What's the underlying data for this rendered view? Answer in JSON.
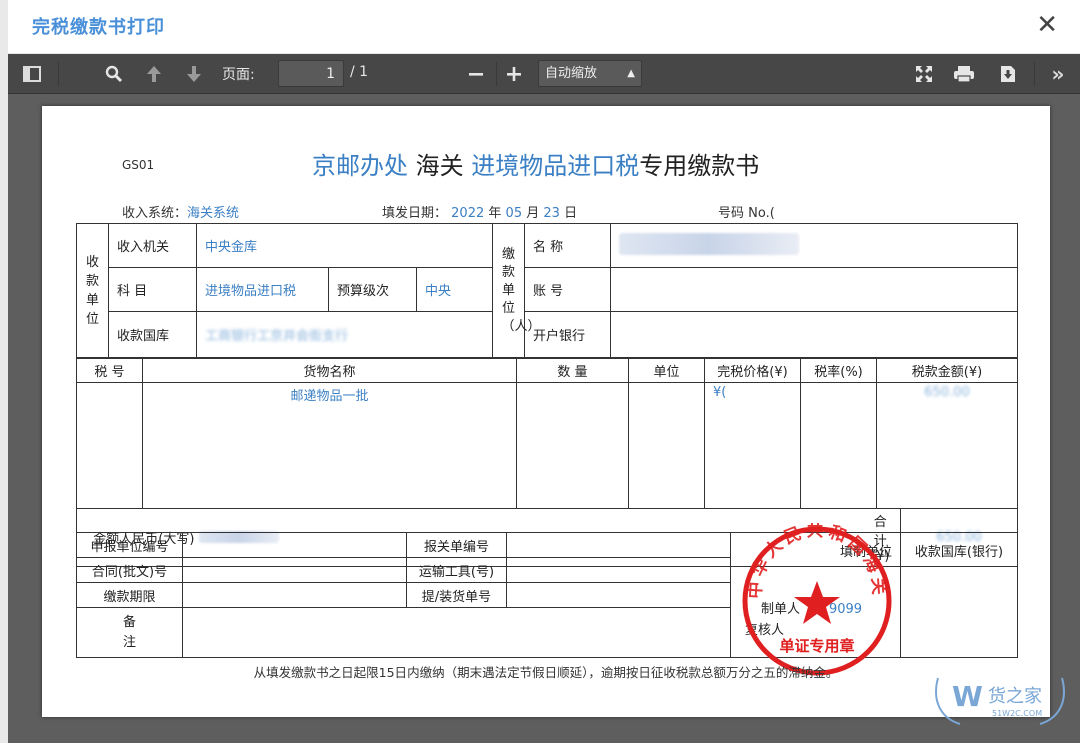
{
  "modal": {
    "title": "完税缴款书打印",
    "close_glyph": "✕"
  },
  "toolbar": {
    "page_label": "页面:",
    "page_value": "1",
    "page_total": "/ 1",
    "zoom_value": "自动缩放"
  },
  "doc": {
    "code": "GS01",
    "title_part1": "京邮办处",
    "title_part2": "海关",
    "title_part3": "进境物品进口税",
    "title_part4": "专用缴款书",
    "income_system_label": "收入系统：",
    "income_system_value": "海关系统",
    "fill_date_label": "填发日期：",
    "fill_date_year": "2022",
    "fill_date_year_unit": "年",
    "fill_date_month": "05",
    "fill_date_month_unit": "月",
    "fill_date_day": "23",
    "fill_date_day_unit": "日",
    "number_label": "号码 No.(",
    "collector_group": "收款单位",
    "receiver_label": "收入机关",
    "receiver_value": "中央金库",
    "subject_label": "科 目",
    "subject_value": "进境物品进口税",
    "budget_label": "预算级次",
    "budget_value": "中央",
    "treasury_label": "收款国库",
    "treasury_value": "工商银行工京井会街支行",
    "payer_group": "缴款单位（人）",
    "name_label": "名 称",
    "account_label": "账 号",
    "bank_label": "开户银行",
    "col_tax_no": "税 号",
    "col_goods": "货物名称",
    "col_qty": "数 量",
    "col_unit": "单位",
    "col_price": "完税价格(¥)",
    "col_rate": "税率(%)",
    "col_amount": "税款金额(¥)",
    "goods_value": "邮递物品一批",
    "price_value": "¥(",
    "amount_value": "650.00",
    "total_cn_label": "金额人民币(大写)",
    "total_label": "合计(¥)",
    "total_value": "650.00",
    "declarer_label": "申报单位编号",
    "declaration_label": "报关单编号",
    "contract_label": "合同(批文)号",
    "transport_label": "运输工具(号)",
    "deadline_label": "缴款期限",
    "bill_label": "提/装货单号",
    "issuer_label": "填制单位",
    "issuer_person_label": "制单人",
    "issuer_person_value": "9099",
    "reviewer_label": "复核人",
    "bank_col_label": "收款国库(银行)",
    "remark_label": "备注",
    "notice": "从填发缴款书之日起限15日内缴纳（期末遇法定节假日顺延），逾期按日征收税款总额万分之五的滞纳金。",
    "stamp_text": "中华人民共和国海关",
    "stamp_sub": "单证专用章"
  },
  "watermark": {
    "brand": "货之家",
    "url": "51W2C.COM"
  }
}
